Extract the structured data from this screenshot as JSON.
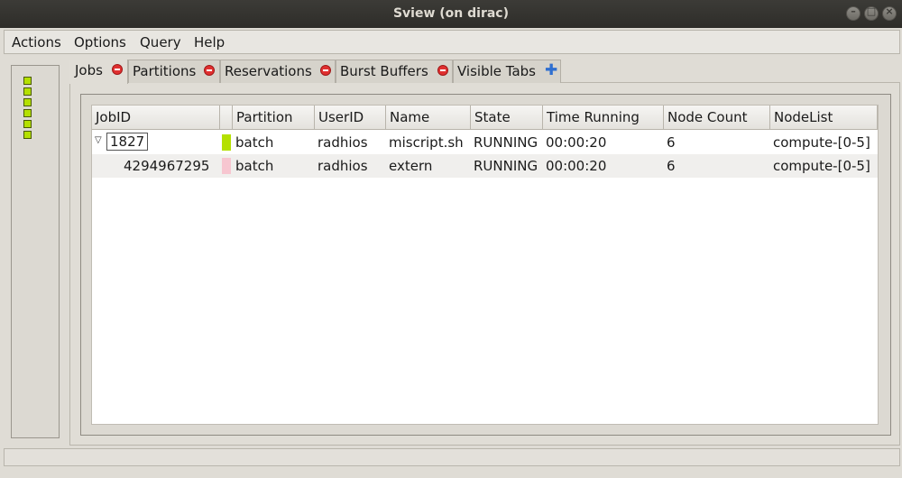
{
  "window": {
    "title": "Sview (on dirac)"
  },
  "menubar": {
    "items": [
      "Actions",
      "Options",
      "Query",
      "Help"
    ]
  },
  "left_panel": {
    "node_count_indicators": 6,
    "node_color": "#b4e000"
  },
  "tabs": [
    {
      "label": "Jobs",
      "icon": "close-icon",
      "active": true
    },
    {
      "label": "Partitions",
      "icon": "close-icon",
      "active": false
    },
    {
      "label": "Reservations",
      "icon": "close-icon",
      "active": false
    },
    {
      "label": "Burst Buffers",
      "icon": "close-icon",
      "active": false
    },
    {
      "label": "Visible Tabs",
      "icon": "plus-icon",
      "active": false
    }
  ],
  "table": {
    "columns": [
      "JobID",
      "",
      "Partition",
      "UserID",
      "Name",
      "State",
      "Time Running",
      "Node Count",
      "NodeList"
    ],
    "rows": [
      {
        "expander": "▽",
        "jobid": "1827",
        "color": "#b4e000",
        "partition": "batch",
        "userid": "radhios",
        "name": "miscript.sh",
        "state": "RUNNING",
        "time_running": "00:00:20",
        "node_count": "6",
        "nodelist": "compute-[0-5]"
      },
      {
        "expander": "",
        "jobid": "4294967295",
        "color": "#f7c6d0",
        "partition": "batch",
        "userid": "radhios",
        "name": "extern",
        "state": "RUNNING",
        "time_running": "00:00:20",
        "node_count": "6",
        "nodelist": "compute-[0-5]"
      }
    ]
  },
  "statusbar": {
    "text": ""
  }
}
